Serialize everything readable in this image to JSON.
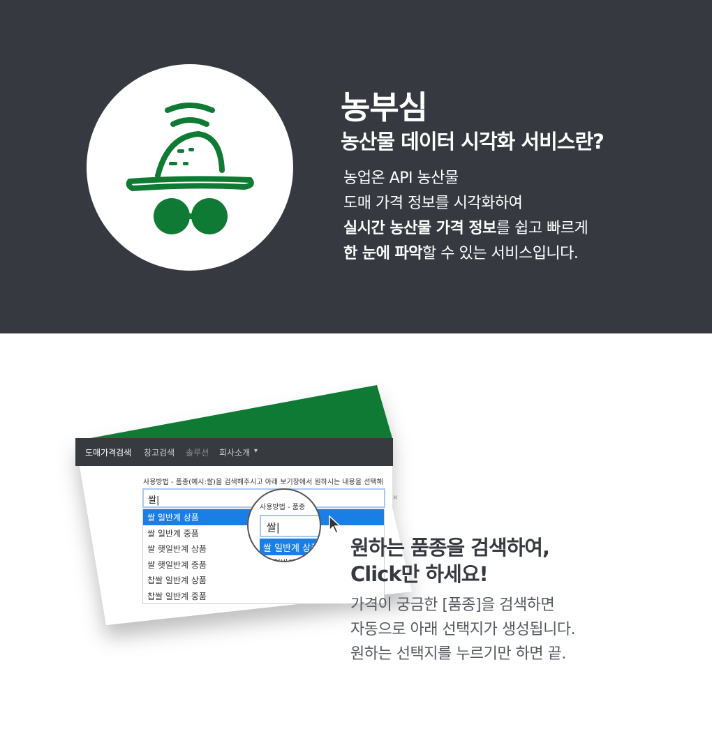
{
  "hero": {
    "brand_title": "농부심",
    "brand_subtitle": "농산물 데이터 시각화 서비스란?",
    "desc_line1": "농업온 API 농산물",
    "desc_line2": "도매 가격 정보를 시각화하여",
    "desc_line3_bold": "실시간 농산물 가격 정보",
    "desc_line3_rest": "를 쉽고 빠르게",
    "desc_line4_bold": "한 눈에 파악",
    "desc_line4_rest": "할 수 있는 서비스입니다.",
    "logo_icon": "farmer-hat-glasses-icon",
    "brand_color": "#0e7a33",
    "bg_color": "#363a40"
  },
  "app": {
    "nav": {
      "brand": "도매가격검색",
      "items": [
        "창고검색",
        "솔루션",
        "회사소개"
      ],
      "dropdown_caret": "▾"
    },
    "usage_text": "사용방법 - 품종(예시:쌀)을 검색해주시고 아래 보기창에서 원하시는 내용을 선택해",
    "search_value": "쌀|",
    "clear_label": "×",
    "suggestions": [
      "쌀 일반계 상품",
      "쌀 일반계 중품",
      "쌀 햇일반계 상품",
      "쌀 햇일반계 중품",
      "찹쌀 일반계 상품",
      "찹쌀 일반계 중품"
    ],
    "magnifier": {
      "usage": "사용방법 - 품종",
      "input": "쌀|",
      "selected": "쌀 일반계 상품",
      "next": "쌀 일반계"
    }
  },
  "feature": {
    "title_line1": "원하는 품종을 검색하여,",
    "title_line2": "Click만 하세요!",
    "desc_line1": "가격이 궁금한 [품종]을 검색하면",
    "desc_line2": "자동으로 아래 선택지가 생성됩니다.",
    "desc_line3": "원하는 선택지를 누르기만 하면 끝."
  }
}
